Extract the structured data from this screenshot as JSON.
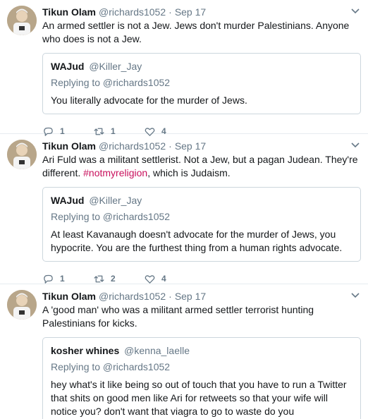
{
  "colors": {
    "hashtag": "#c8105c",
    "muted": "#657786",
    "border": "#e6ecf0"
  },
  "tweets": [
    {
      "name": "Tikun Olam",
      "handle": "@richards1052",
      "dot": "·",
      "date": "Sep 17",
      "text_before": "An armed settler is not a Jew.  Jews don't murder Palestinians.  Anyone who does is not a Jew.",
      "hashtag": "",
      "text_after": "",
      "quote": {
        "name": "WAJud",
        "handle": "@Killer_Jay",
        "replying": "Replying to @richards1052",
        "text": "You literally advocate for the murder of Jews."
      },
      "replies": "1",
      "retweets": "1",
      "likes": "4"
    },
    {
      "name": "Tikun Olam",
      "handle": "@richards1052",
      "dot": "·",
      "date": "Sep 17",
      "text_before": "Ari Fuld was a militant settlerist. Not a Jew, but a pagan Judean. They're different. ",
      "hashtag": "#notmyreligion",
      "text_after": ", which is Judaism.",
      "quote": {
        "name": "WAJud",
        "handle": "@Killer_Jay",
        "replying": "Replying to @richards1052",
        "text": "At least Kavanaugh doesn't advocate for the murder of Jews, you hypocrite. You are the furthest thing from a human rights advocate."
      },
      "replies": "1",
      "retweets": "2",
      "likes": "4"
    },
    {
      "name": "Tikun Olam",
      "handle": "@richards1052",
      "dot": "·",
      "date": "Sep 17",
      "text_before": "A 'good man' who was a militant armed settler terrorist hunting Palestinians for kicks.",
      "hashtag": "",
      "text_after": "",
      "quote": {
        "name": "kosher whines",
        "handle": "@kenna_laelle",
        "replying": "Replying to @richards1052",
        "text": "hey what's it like being so out of touch that you have to run a Twitter that shits on good men like Ari for retweets so that your wife will notice you? don't want that viagra to go to waste do you"
      }
    }
  ]
}
